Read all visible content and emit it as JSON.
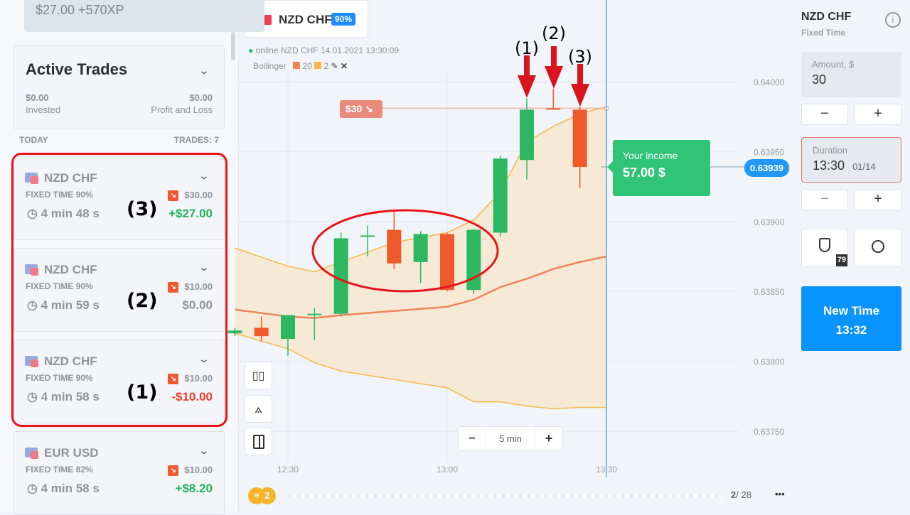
{
  "banner": {
    "text": "$27.00 +570XP"
  },
  "active_trades": {
    "title": "Active Trades",
    "invested_value": "$0.00",
    "invested_label": "Invested",
    "pl_value": "$0.00",
    "pl_label": "Profit and Loss"
  },
  "today": {
    "label": "TODAY",
    "trades": "TRADES: 7"
  },
  "trades": [
    {
      "pair": "NZD CHF",
      "type": "FIXED TIME 90%",
      "amount": "$30.00",
      "timer": "4 min 48 s",
      "result": "+$27.00",
      "result_color": "#22b35e",
      "annotation": "(3)"
    },
    {
      "pair": "NZD CHF",
      "type": "FIXED TIME 90%",
      "amount": "$10.00",
      "timer": "4 min 59 s",
      "result": "$0.00",
      "result_color": "#8d949d",
      "annotation": "(2)"
    },
    {
      "pair": "NZD CHF",
      "type": "FIXED TIME 90%",
      "amount": "$10.00",
      "timer": "4 min 58 s",
      "result": "-$10.00",
      "result_color": "#ec3b2e",
      "annotation": "(1)"
    },
    {
      "pair": "EUR USD",
      "type": "FIXED TIME 82%",
      "amount": "$10.00",
      "timer": "4 min 58 s",
      "result": "+$8.20",
      "result_color": "#22b35e",
      "annotation": ""
    }
  ],
  "chart_tab": {
    "pair": "NZD CHF",
    "payout": "90%"
  },
  "chart_info": {
    "status": "online NZD CHF  14.01.2021 13:30:09",
    "indicator": "Bollinger",
    "period": "20",
    "deviation": "2"
  },
  "strike_label": "$30",
  "income": {
    "label": "Your income",
    "value": "57.00 $"
  },
  "current_price": "0.63939",
  "timeframe": {
    "minus": "−",
    "value": "5 min",
    "plus": "+"
  },
  "arrow_annotations": [
    "(1)",
    "(2)",
    "(3)"
  ],
  "pager": {
    "badge": "2",
    "current": "2",
    "total": "/ 28",
    "more": "•••"
  },
  "right": {
    "pair": "NZD CHF",
    "mode": "Fixed Time",
    "amount_label": "Amount, $",
    "amount": "30",
    "duration_label": "Duration",
    "duration": "13:30",
    "duration_date": "01/14",
    "minus": "−",
    "plus": "+",
    "shield_count": "79",
    "new_time_label": "New Time",
    "new_time": "13:32"
  },
  "colors": {
    "up": "#2db760",
    "down": "#f05a2b",
    "band": "#f5b74a",
    "middle": "#f0845a",
    "accent": "#1a8cff",
    "income": "#2fc476"
  },
  "chart_data": {
    "type": "candlestick",
    "y_ticks": [
      "0.64000",
      "0.63950",
      "0.63900",
      "0.63850",
      "0.63800",
      "0.63750"
    ],
    "x_ticks": [
      "12:30",
      "13:00",
      "13:30"
    ],
    "ylim": [
      0.63727,
      0.64015
    ],
    "candles": [
      {
        "t": "12:20",
        "o": 0.6382,
        "h": 0.63824,
        "l": 0.63818,
        "c": 0.63822
      },
      {
        "t": "12:25",
        "o": 0.63824,
        "h": 0.63832,
        "l": 0.63814,
        "c": 0.63818
      },
      {
        "t": "12:30",
        "o": 0.63816,
        "h": 0.63833,
        "l": 0.63804,
        "c": 0.63833
      },
      {
        "t": "12:35",
        "o": 0.63833,
        "h": 0.63838,
        "l": 0.63815,
        "c": 0.63834
      },
      {
        "t": "12:40",
        "o": 0.63834,
        "h": 0.63892,
        "l": 0.63832,
        "c": 0.63888
      },
      {
        "t": "12:45",
        "o": 0.63889,
        "h": 0.63897,
        "l": 0.63875,
        "c": 0.6389
      },
      {
        "t": "12:50",
        "o": 0.63894,
        "h": 0.63907,
        "l": 0.63866,
        "c": 0.6387
      },
      {
        "t": "12:55",
        "o": 0.63871,
        "h": 0.63893,
        "l": 0.63856,
        "c": 0.63891
      },
      {
        "t": "13:00",
        "o": 0.63891,
        "h": 0.63892,
        "l": 0.6385,
        "c": 0.63851
      },
      {
        "t": "13:05",
        "o": 0.63851,
        "h": 0.63895,
        "l": 0.63848,
        "c": 0.63894
      },
      {
        "t": "13:10",
        "o": 0.63892,
        "h": 0.63947,
        "l": 0.63889,
        "c": 0.63945
      },
      {
        "t": "13:15",
        "o": 0.63944,
        "h": 0.63988,
        "l": 0.6393,
        "c": 0.6398
      },
      {
        "t": "13:20",
        "o": 0.63981,
        "h": 0.63995,
        "l": 0.6398,
        "c": 0.6398
      },
      {
        "t": "13:25",
        "o": 0.6398,
        "h": 0.63982,
        "l": 0.63924,
        "c": 0.63939
      }
    ],
    "bollinger": {
      "t": [
        "12:20",
        "12:30",
        "12:35",
        "12:40",
        "12:50",
        "13:00",
        "13:05",
        "13:10",
        "13:15",
        "13:20",
        "13:25",
        "13:30"
      ],
      "upper": [
        0.63881,
        0.63868,
        0.63864,
        0.63871,
        0.63885,
        0.63892,
        0.63901,
        0.63921,
        0.63957,
        0.63968,
        0.63977,
        0.63982
      ],
      "middle": [
        0.63837,
        0.63832,
        0.63831,
        0.63833,
        0.63836,
        0.63839,
        0.63844,
        0.63853,
        0.63859,
        0.63866,
        0.63871,
        0.63875
      ],
      "lower": [
        0.6382,
        0.63809,
        0.63799,
        0.63793,
        0.63787,
        0.63781,
        0.63771,
        0.63771,
        0.63768,
        0.63766,
        0.63767,
        0.63767
      ]
    },
    "strike_price": 0.63981,
    "current_price": 0.63939,
    "now": "13:30"
  }
}
